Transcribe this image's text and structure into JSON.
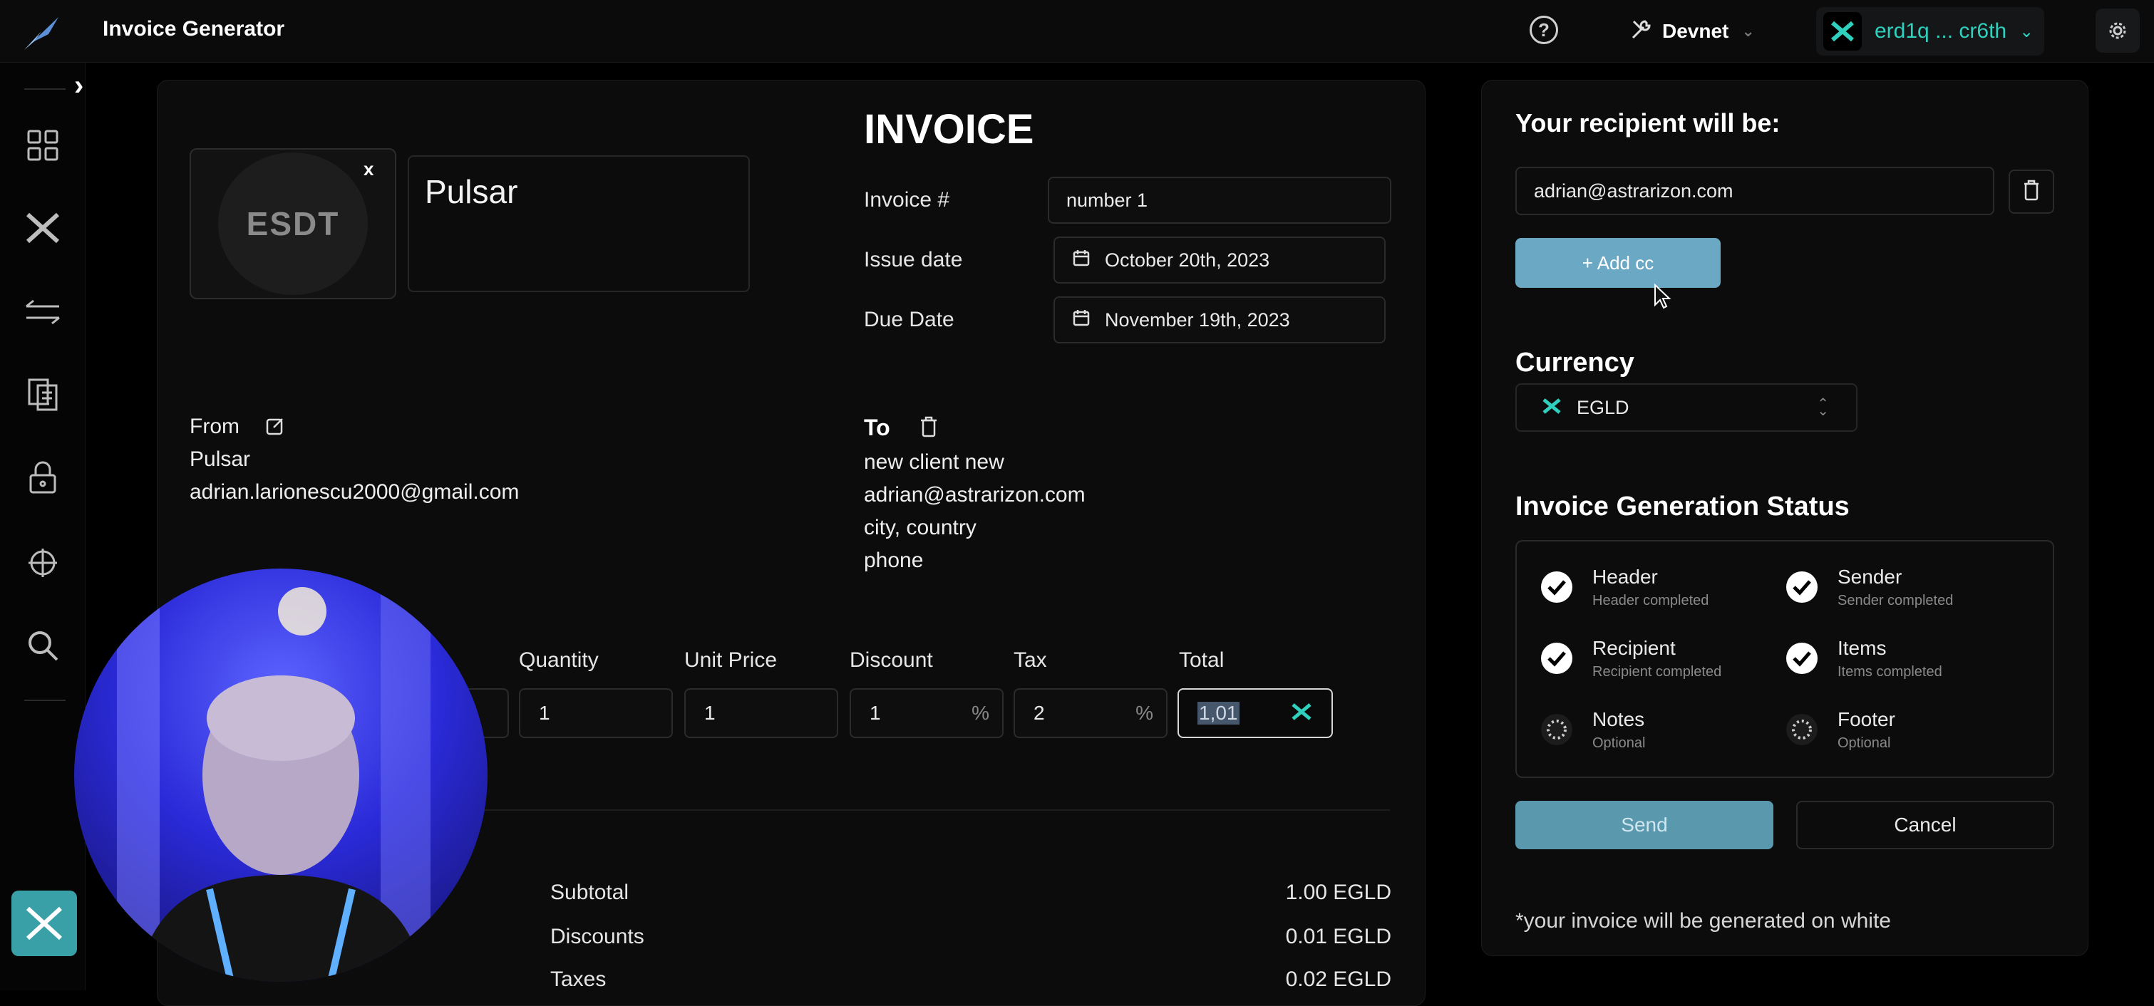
{
  "app": {
    "title": "Invoice Generator"
  },
  "header": {
    "network": "Devnet",
    "wallet_address": "erd1q ... cr6th",
    "colors": {
      "accent": "#2fd0bd"
    }
  },
  "sidebar": {
    "items": [
      {
        "icon": "dashboard-grid-icon"
      },
      {
        "icon": "multiversx-icon"
      },
      {
        "icon": "transfer-arrows-icon"
      },
      {
        "icon": "documents-icon"
      },
      {
        "icon": "lock-icon"
      },
      {
        "icon": "globe-icon"
      },
      {
        "icon": "search-icon"
      }
    ],
    "active_icon": "multiversx-icon"
  },
  "invoice": {
    "logo_text": "ESDT",
    "logo_remove": "x",
    "company_name": "Pulsar",
    "title": "INVOICE",
    "number_label": "Invoice #",
    "number_value": "number 1",
    "issue_label": "Issue date",
    "issue_value": "October 20th, 2023",
    "due_label": "Due Date",
    "due_value": "November 19th, 2023",
    "from": {
      "label": "From",
      "name": "Pulsar",
      "email": "adrian.larionescu2000@gmail.com"
    },
    "to": {
      "label": "To",
      "name": "new client new",
      "email": "adrian@astrarizon.com",
      "address": "city, country",
      "phone": "phone"
    },
    "items": {
      "headers": {
        "quantity": "Quantity",
        "unit_price": "Unit Price",
        "discount": "Discount",
        "tax": "Tax",
        "total": "Total"
      },
      "row": {
        "quantity": "1",
        "unit_price": "1",
        "discount": "1",
        "tax": "2",
        "total": "1,01",
        "pct": "%"
      }
    },
    "summary": [
      {
        "label": "Subtotal",
        "value": "1.00 EGLD"
      },
      {
        "label": "Discounts",
        "value": "0.01 EGLD"
      },
      {
        "label": "Taxes",
        "value": "0.02 EGLD"
      }
    ]
  },
  "recipient_panel": {
    "title": "Your recipient will be:",
    "email": "adrian@astrarizon.com",
    "add_cc": "+ Add cc",
    "currency_title": "Currency",
    "currency": "EGLD",
    "status_title": "Invoice Generation Status",
    "status": [
      {
        "name": "Header",
        "sub": "Header completed",
        "done": true
      },
      {
        "name": "Sender",
        "sub": "Sender completed",
        "done": true
      },
      {
        "name": "Recipient",
        "sub": "Recipient completed",
        "done": true
      },
      {
        "name": "Items",
        "sub": "Items completed",
        "done": true
      },
      {
        "name": "Notes",
        "sub": "Optional",
        "done": false
      },
      {
        "name": "Footer",
        "sub": "Optional",
        "done": false
      }
    ],
    "send": "Send",
    "cancel": "Cancel",
    "footnote": "*your invoice will be generated on white"
  }
}
